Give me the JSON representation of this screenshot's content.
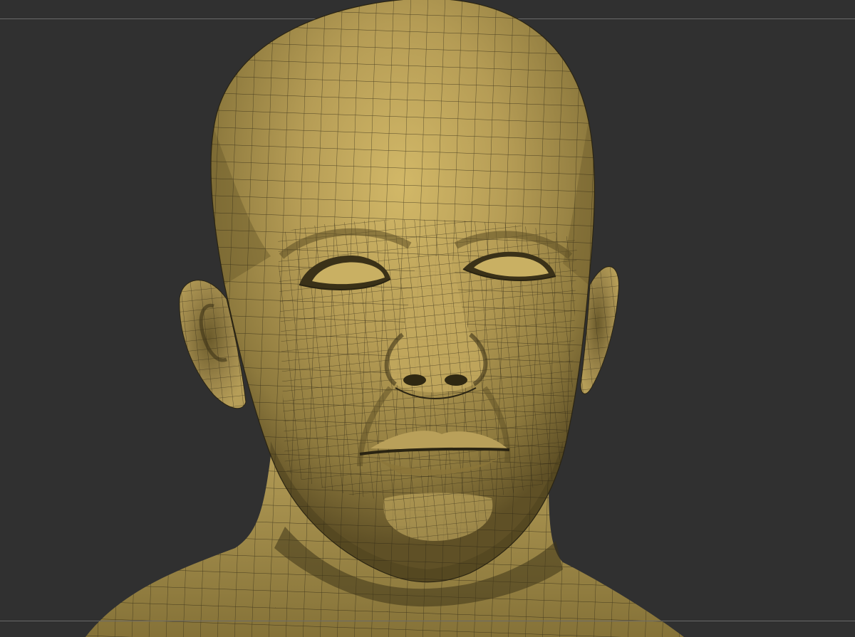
{
  "viewport": {
    "background_color": "#303030",
    "guide_line_color": "#6a6a6a"
  },
  "model": {
    "subject": "head-bust",
    "display": "polyframe-wireframe",
    "material_color": "#a8914c",
    "highlight_color": "#d2b868",
    "shadow_color": "#3e3418",
    "wire_color": "#2a2412"
  }
}
